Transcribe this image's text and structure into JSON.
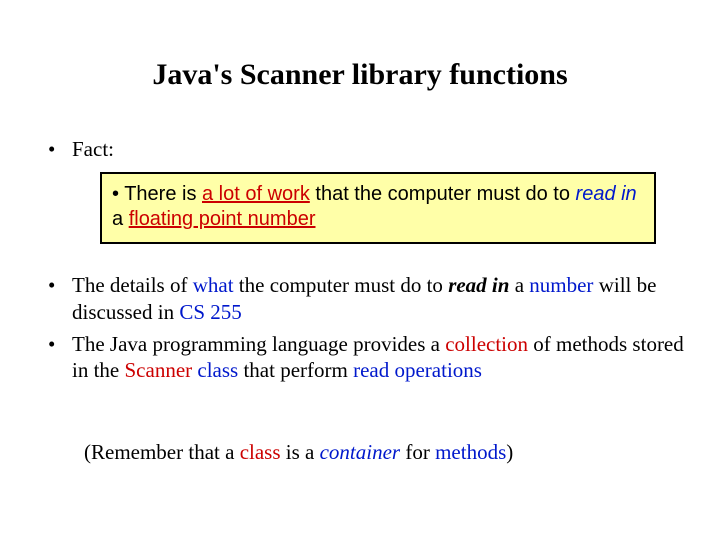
{
  "title": "Java's Scanner library functions",
  "fact_label": "Fact:",
  "callout": {
    "pre": "• There is ",
    "a_lot_of_work": "a lot of work",
    "mid": " that the computer must do to ",
    "read_in": "read in",
    "a": " a ",
    "float_num": "floating point number"
  },
  "detail1": {
    "p1": "The details of ",
    "what": "what",
    "p2": " the computer must do to ",
    "read_in": "read in",
    "p3": " a ",
    "number": "number",
    "p4": " will be discussed in ",
    "course": "CS 255"
  },
  "detail2": {
    "p1": "The Java programming language provides a ",
    "collection": "collection",
    "p2": " of methods stored in the ",
    "scanner": "Scanner",
    "p3": " ",
    "class": "class",
    "p4": " that perform ",
    "read_ops": "read operations"
  },
  "foot": {
    "p1": "(Remember that a ",
    "class": "class",
    "p2": " is a ",
    "container": "container",
    "p3": " for ",
    "methods": "methods",
    "p4": ")"
  }
}
